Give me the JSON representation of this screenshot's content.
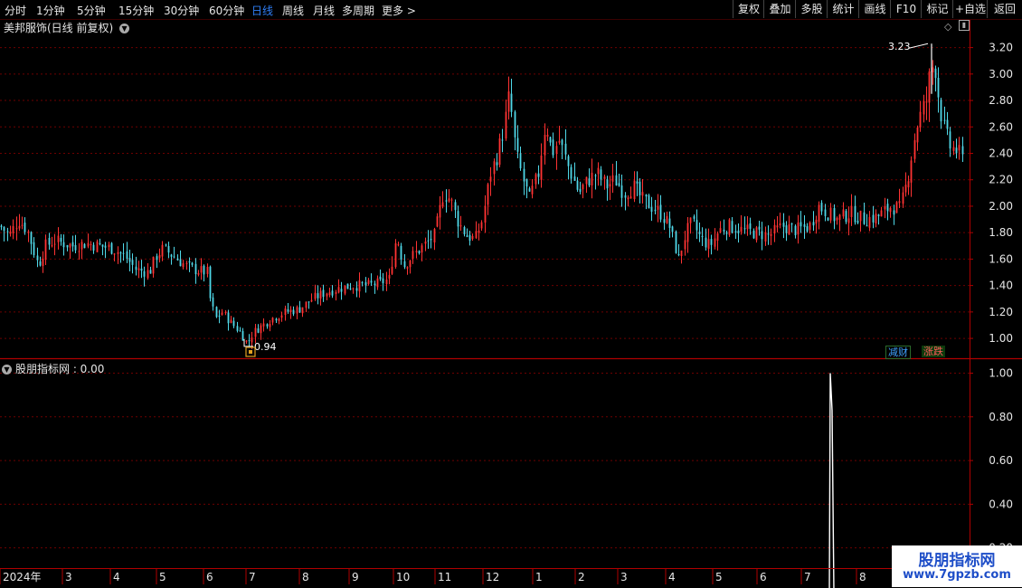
{
  "toolbar": {
    "periods": [
      "分时",
      "1分钟",
      "5分钟",
      "15分钟",
      "30分钟",
      "60分钟",
      "日线",
      "周线",
      "月线",
      "多周期",
      "更多 >"
    ],
    "active_period": "日线",
    "right_buttons": [
      "复权",
      "叠加",
      "多股",
      "统计",
      "画线",
      "F10",
      "标记",
      "+自选",
      "返回"
    ]
  },
  "stock": {
    "title": "美邦服饰(日线 前复权)"
  },
  "indicator": {
    "title": "股朋指标网 : 0.00"
  },
  "tags": {
    "a": "减财",
    "b": "涨跌"
  },
  "watermark": {
    "line1": "股朋指标网",
    "line2": "www.7gpzb.com"
  },
  "icons": {
    "dropdown": "chevron-down-icon",
    "diamond": "diamond-icon",
    "toggle": "panel-toggle-icon",
    "marker": "square-marker-icon"
  },
  "colors": {
    "up": "#ff3333",
    "down": "#4fd8e8",
    "grid": "#6e0000",
    "axis": "#b00000",
    "indicator_line": "#ffffff"
  },
  "chart_data": [
    {
      "type": "candlestick",
      "title": "美邦服饰(日线 前复权)",
      "ylim": [
        0.85,
        3.3
      ],
      "y_ticks": [
        "3.20",
        "3.00",
        "2.80",
        "2.60",
        "2.40",
        "2.20",
        "2.00",
        "1.80",
        "1.60",
        "1.40",
        "1.20",
        "1.00"
      ],
      "x_labels": [
        "2024年",
        "3",
        "4",
        "5",
        "6",
        "7",
        "8",
        "9",
        "10",
        "11",
        "12",
        "1",
        "2",
        "3",
        "4",
        "5",
        "6",
        "7",
        "8"
      ],
      "annotations": [
        {
          "text": "3.23",
          "value": 3.23,
          "kind": "high"
        },
        {
          "text": "0.94",
          "value": 0.94,
          "kind": "low"
        }
      ],
      "close_path": [
        [
          0,
          1.85
        ],
        [
          10,
          1.78
        ],
        [
          20,
          1.9
        ],
        [
          30,
          1.82
        ],
        [
          42,
          1.55
        ],
        [
          50,
          1.7
        ],
        [
          60,
          1.74
        ],
        [
          70,
          1.72
        ],
        [
          80,
          1.7
        ],
        [
          95,
          1.72
        ],
        [
          110,
          1.7
        ],
        [
          125,
          1.68
        ],
        [
          138,
          1.62
        ],
        [
          150,
          1.52
        ],
        [
          165,
          1.5
        ],
        [
          172,
          1.62
        ],
        [
          180,
          1.68
        ],
        [
          192,
          1.62
        ],
        [
          205,
          1.55
        ],
        [
          215,
          1.52
        ],
        [
          228,
          1.5
        ],
        [
          232,
          1.3
        ],
        [
          238,
          1.15
        ],
        [
          245,
          1.2
        ],
        [
          255,
          1.12
        ],
        [
          265,
          1.05
        ],
        [
          273,
          0.96
        ],
        [
          280,
          1.05
        ],
        [
          290,
          1.1
        ],
        [
          300,
          1.15
        ],
        [
          315,
          1.2
        ],
        [
          330,
          1.22
        ],
        [
          345,
          1.3
        ],
        [
          360,
          1.35
        ],
        [
          375,
          1.38
        ],
        [
          390,
          1.4
        ],
        [
          405,
          1.4
        ],
        [
          420,
          1.42
        ],
        [
          430,
          1.45
        ],
        [
          438,
          1.78
        ],
        [
          446,
          1.55
        ],
        [
          455,
          1.62
        ],
        [
          468,
          1.7
        ],
        [
          480,
          1.78
        ],
        [
          490,
          2.1
        ],
        [
          498,
          2.05
        ],
        [
          505,
          1.9
        ],
        [
          515,
          1.78
        ],
        [
          525,
          1.75
        ],
        [
          533,
          1.9
        ],
        [
          542,
          2.25
        ],
        [
          550,
          2.4
        ],
        [
          557,
          2.6
        ],
        [
          563,
          2.85
        ],
        [
          570,
          2.4
        ],
        [
          578,
          2.2
        ],
        [
          585,
          2.05
        ],
        [
          595,
          2.25
        ],
        [
          603,
          2.65
        ],
        [
          610,
          2.4
        ],
        [
          618,
          2.5
        ],
        [
          628,
          2.3
        ],
        [
          640,
          2.1
        ],
        [
          650,
          2.2
        ],
        [
          660,
          2.25
        ],
        [
          670,
          2.15
        ],
        [
          680,
          2.2
        ],
        [
          690,
          2.1
        ],
        [
          700,
          2.15
        ],
        [
          710,
          2.05
        ],
        [
          720,
          2.0
        ],
        [
          730,
          1.95
        ],
        [
          740,
          1.85
        ],
        [
          750,
          1.6
        ],
        [
          758,
          1.8
        ],
        [
          765,
          1.88
        ],
        [
          775,
          1.75
        ],
        [
          785,
          1.7
        ],
        [
          795,
          1.82
        ],
        [
          805,
          1.85
        ],
        [
          820,
          1.82
        ],
        [
          835,
          1.8
        ],
        [
          850,
          1.78
        ],
        [
          865,
          1.85
        ],
        [
          880,
          1.82
        ],
        [
          895,
          1.85
        ],
        [
          905,
          2.0
        ],
        [
          915,
          1.95
        ],
        [
          925,
          1.9
        ],
        [
          940,
          1.95
        ],
        [
          955,
          1.9
        ],
        [
          970,
          1.92
        ],
        [
          985,
          2.0
        ],
        [
          995,
          1.98
        ],
        [
          1003,
          2.2
        ],
        [
          1008,
          2.4
        ],
        [
          1013,
          2.6
        ],
        [
          1018,
          2.7
        ],
        [
          1024,
          2.8
        ],
        [
          1028,
          3.0
        ],
        [
          1033,
          3.1
        ],
        [
          1038,
          2.8
        ],
        [
          1043,
          2.6
        ],
        [
          1050,
          2.45
        ],
        [
          1058,
          2.42
        ],
        [
          1064,
          2.35
        ]
      ]
    },
    {
      "type": "line",
      "title": "股朋指标网 : 0.00",
      "ylim": [
        0.12,
        1.06
      ],
      "y_ticks": [
        "1.00",
        "0.80",
        "0.60",
        "0.40",
        "0.20"
      ],
      "series": [
        {
          "values": [
            [
              0,
              0
            ],
            [
              917,
              0
            ],
            [
              918,
              1.0
            ],
            [
              920,
              0.83
            ],
            [
              922,
              0
            ],
            [
              1070,
              0
            ]
          ]
        }
      ]
    }
  ]
}
